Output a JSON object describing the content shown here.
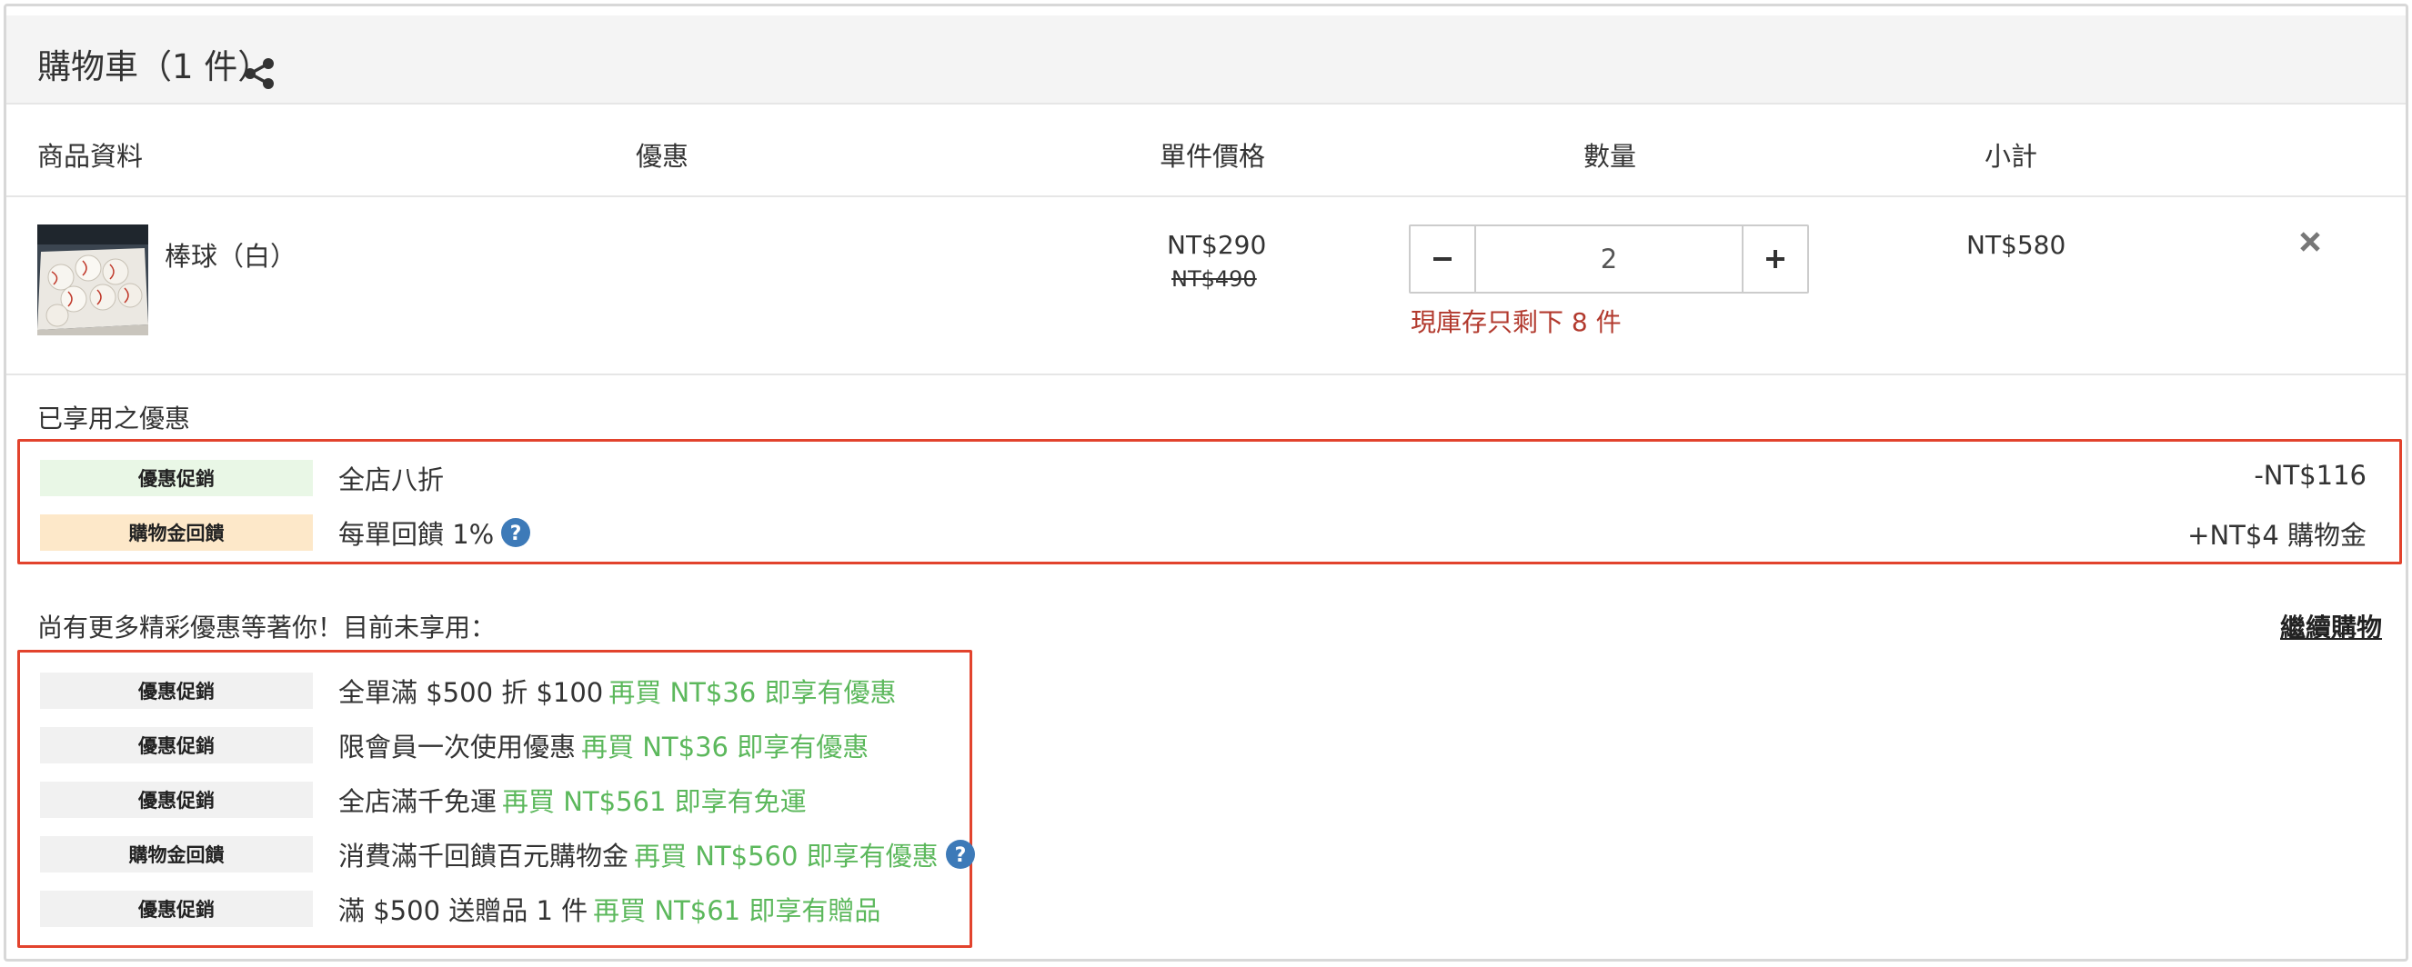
{
  "cart": {
    "title": "購物車（1 件）",
    "share_icon": "share-icon"
  },
  "columns": {
    "product": "商品資料",
    "discount": "優惠",
    "unit_price": "單件價格",
    "quantity": "數量",
    "subtotal": "小計"
  },
  "item": {
    "name": "棒球（白）",
    "price": "NT$290",
    "original_price": "NT$490",
    "quantity": "2",
    "stock_message": "現庫存只剩下 8 件",
    "subtotal": "NT$580",
    "remove_icon": "close-icon"
  },
  "applied": {
    "title": "已享用之優惠",
    "promos": [
      {
        "badge": "優惠促銷",
        "text": "全店八折",
        "amount": "-NT$116"
      },
      {
        "badge": "購物金回饋",
        "text": "每單回饋 1%",
        "amount": "+NT$4 購物金"
      }
    ]
  },
  "more": {
    "title": "尚有更多精彩優惠等著你！目前未享用：",
    "continue_label": "繼續購物",
    "promos": [
      {
        "badge": "優惠促銷",
        "text": "全單滿 $500 折 $100",
        "hint": "再買 NT$36 即享有優惠"
      },
      {
        "badge": "優惠促銷",
        "text": "限會員一次使用優惠",
        "hint": "再買 NT$36 即享有優惠"
      },
      {
        "badge": "優惠促銷",
        "text": "全店滿千免運",
        "hint": "再買 NT$561 即享有免運"
      },
      {
        "badge": "購物金回饋",
        "text": "消費滿千回饋百元購物金",
        "hint": "再買 NT$560 即享有優惠"
      },
      {
        "badge": "優惠促銷",
        "text": "滿 $500 送贈品 1 件",
        "hint": "再買 NT$61 即享有贈品"
      }
    ]
  },
  "colors": {
    "hint_green": "#5cb85c",
    "warning_red": "#b23a2e",
    "highlight_border": "#e2432d",
    "help_blue": "#3d7ab8"
  }
}
